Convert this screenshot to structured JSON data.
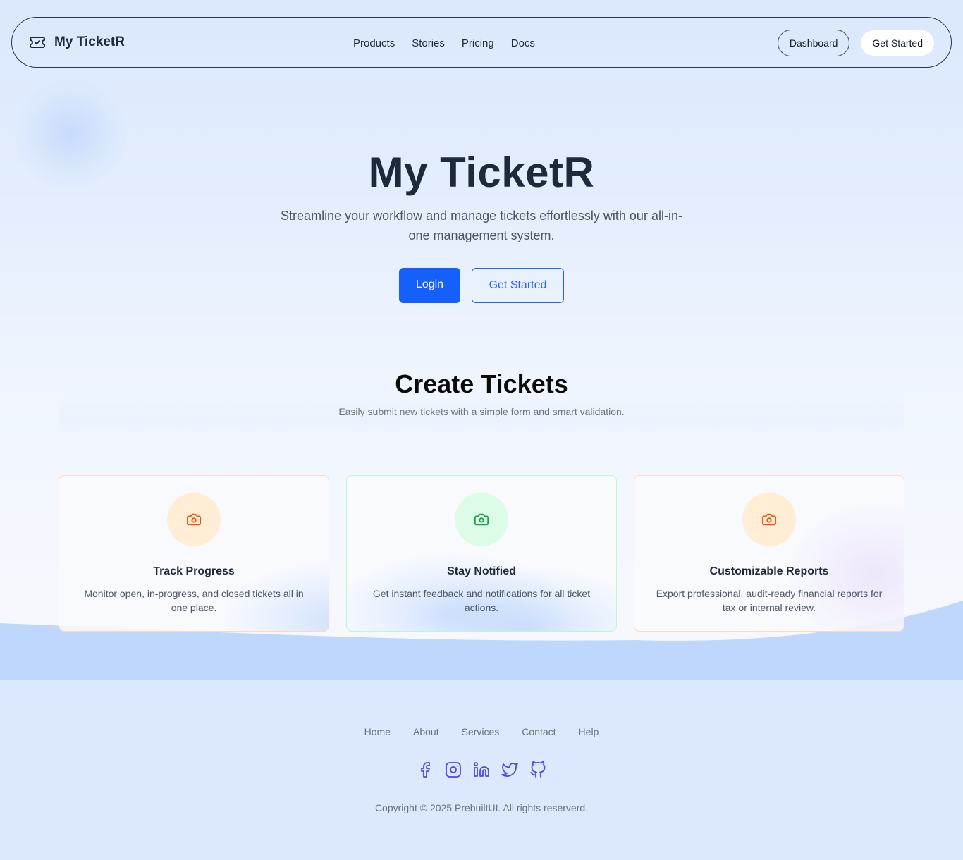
{
  "nav": {
    "brand": "My TicketR",
    "links": [
      "Products",
      "Stories",
      "Pricing",
      "Docs"
    ],
    "dashboard_label": "Dashboard",
    "get_started_label": "Get Started"
  },
  "hero": {
    "title": "My TicketR",
    "subtitle": "Streamline your workflow and manage tickets effortlessly with our all-in-one management system.",
    "login_label": "Login",
    "get_started_label": "Get Started"
  },
  "section": {
    "title": "Create Tickets",
    "subtitle": "Easily submit new tickets with a simple form and smart validation."
  },
  "cards": [
    {
      "title": "Track Progress",
      "text": "Monitor open, in-progress, and closed tickets all in one place.",
      "icon": "camera-icon",
      "accent": "#ea580c"
    },
    {
      "title": "Stay Notified",
      "text": "Get instant feedback and notifications for all ticket actions.",
      "icon": "camera-icon",
      "accent": "#16a34a"
    },
    {
      "title": "Customizable Reports",
      "text": "Export professional, audit-ready financial reports for tax or internal review.",
      "icon": "camera-icon",
      "accent": "#ea580c"
    }
  ],
  "footer": {
    "links": [
      "Home",
      "About",
      "Services",
      "Contact",
      "Help"
    ],
    "socials": [
      "facebook-icon",
      "instagram-icon",
      "linkedin-icon",
      "twitter-icon",
      "github-icon"
    ],
    "copyright": "Copyright © 2025 PrebuiltUI. All rights reserverd."
  },
  "colors": {
    "primary": "#1560fb",
    "social_icon": "#4f46e5",
    "wave": "#bfd7fc"
  }
}
